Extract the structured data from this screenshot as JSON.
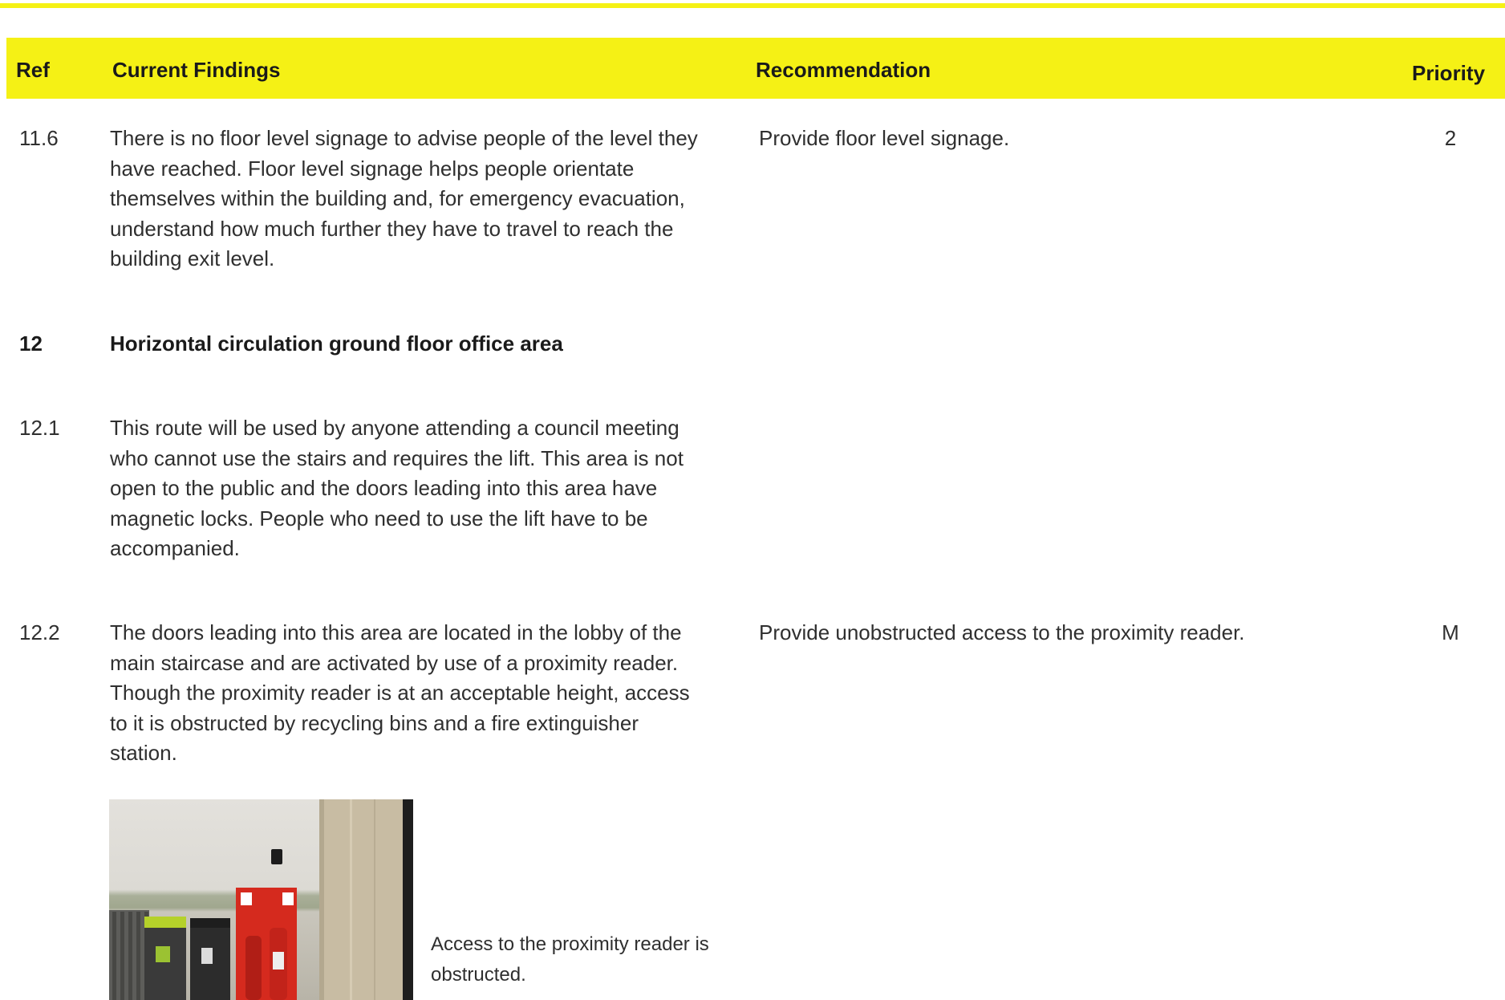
{
  "header": {
    "ref": "Ref",
    "findings": "Current Findings",
    "recommendation": "Recommendation",
    "priority": "Priority"
  },
  "rows": [
    {
      "ref": "11.6",
      "findings": "There is no floor level signage to advise people of the level they have reached. Floor level signage helps people orientate themselves within the building and, for emergency evacuation, understand how much further they have to travel to reach the building exit level.",
      "recommendation": "Provide floor level signage.",
      "priority": "2"
    },
    {
      "ref": "12",
      "findings": "Horizontal circulation ground floor office area",
      "recommendation": "",
      "priority": ""
    },
    {
      "ref": "12.1",
      "findings": "This route will be used by anyone attending a council meeting who cannot use the stairs and requires the lift. This area is not open to the public and the doors leading into this area have magnetic locks. People who need to use the lift have to be accompanied.",
      "recommendation": "",
      "priority": ""
    },
    {
      "ref": "12.2",
      "findings": "The doors leading into this area are located in the lobby of the main staircase and are activated by use of a proximity reader. Though the proximity reader is at an acceptable height, access to it is obstructed by recycling bins and a fire extinguisher station.",
      "recommendation": "Provide unobstructed access to the proximity reader.",
      "priority": "M"
    }
  ],
  "photo_caption": "Access to the proximity reader is obstructed.",
  "colors": {
    "header_bg": "#f5f115",
    "text": "#2f2f2f"
  }
}
